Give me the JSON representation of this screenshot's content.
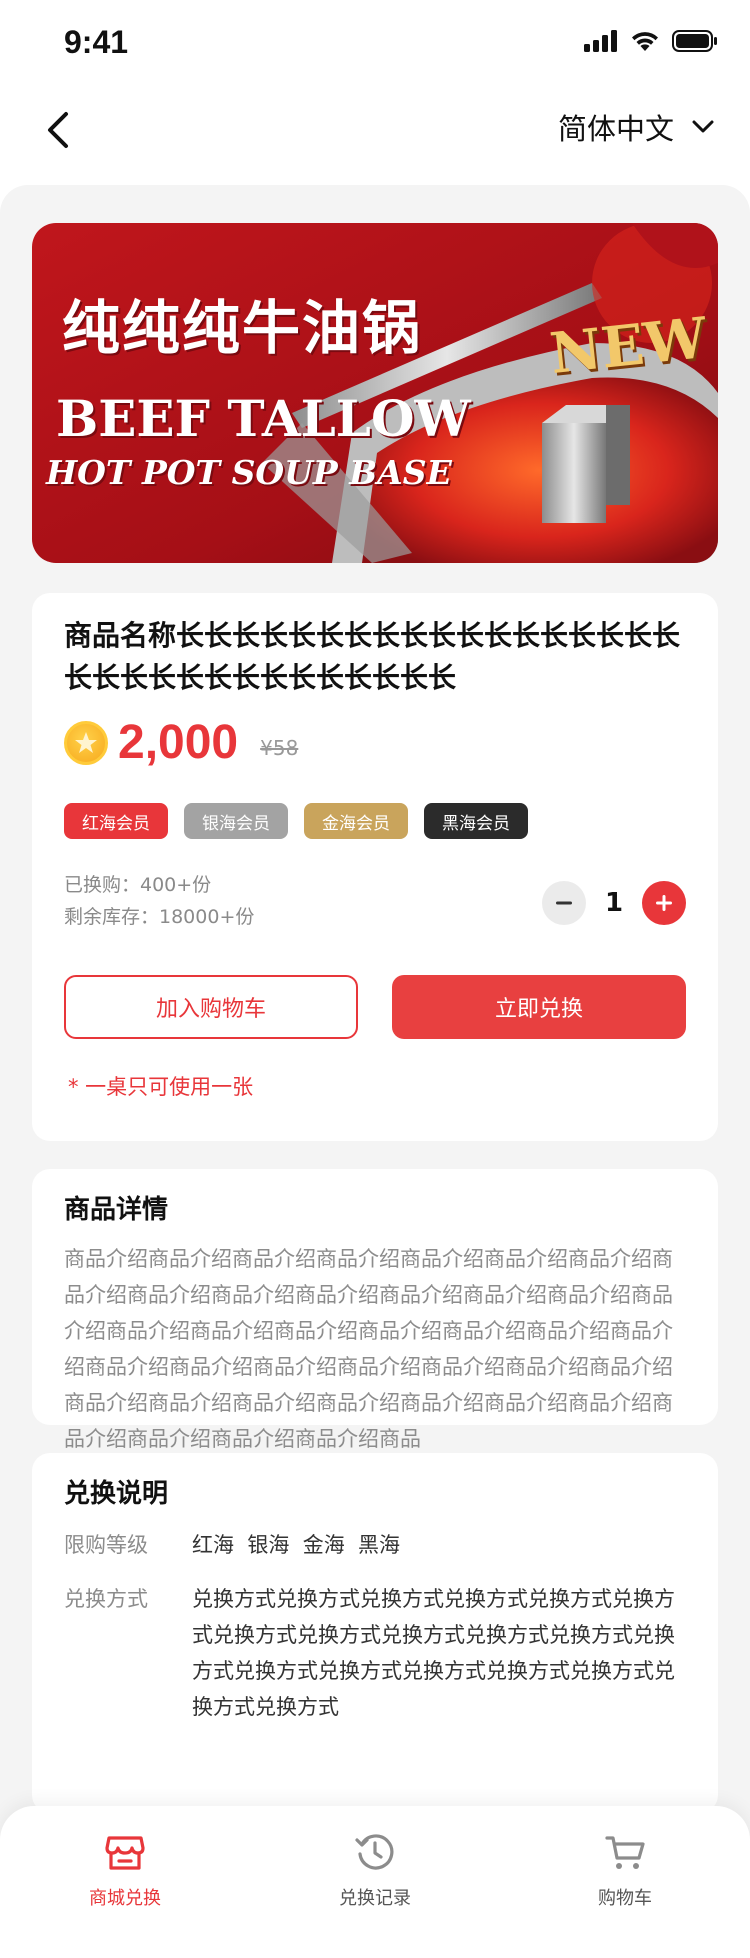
{
  "status_bar": {
    "time": "9:41"
  },
  "nav": {
    "language": "简体中文"
  },
  "banner": {
    "title_cn": "纯纯纯牛油锅",
    "line1": "BEEF TALLOW",
    "line2": "HOT POT SOUP BASE",
    "badge": "NEW"
  },
  "product": {
    "name": "商品名称长长长长长长长长长长长长长长长长长长长长长长长长长长长长长长长长",
    "price": "2,000",
    "original_price": "¥58",
    "tags": [
      {
        "label": "红海会员",
        "color": "#e8363a"
      },
      {
        "label": "银海会员",
        "color": "#a3a3a3"
      },
      {
        "label": "金海会员",
        "color": "#c9a45c"
      },
      {
        "label": "黑海会员",
        "color": "#2b2b2b"
      }
    ],
    "redeemed": "已换购：400+份",
    "stock": "剩余库存：18000+份",
    "quantity": "1",
    "add_to_cart": "加入购物车",
    "redeem_now": "立即兑换",
    "notice": "* 一桌只可使用一张"
  },
  "details": {
    "title": "商品详情",
    "text": "商品介绍商品介绍商品介绍商品介绍商品介绍商品介绍商品介绍商品介绍商品介绍商品介绍商品介绍商品介绍商品介绍商品介绍商品介绍商品介绍商品介绍商品介绍商品介绍商品介绍商品介绍商品介绍商品介绍商品介绍商品介绍商品介绍商品介绍商品介绍商品介绍商品介绍商品介绍商品介绍商品介绍商品介绍商品介绍商品介绍商品介绍商品介绍商品介绍商品介绍商品"
  },
  "exchange": {
    "title": "兑换说明",
    "level_label": "限购等级",
    "level_value": "红海  银海  金海  黑海",
    "method_label": "兑换方式",
    "method_value": "兑换方式兑换方式兑换方式兑换方式兑换方式兑换方式兑换方式兑换方式兑换方式兑换方式兑换方式兑换方式兑换方式兑换方式兑换方式兑换方式兑换方式兑换方式兑换方式"
  },
  "tabbar": {
    "shop": "商城兑换",
    "records": "兑换记录",
    "cart": "购物车"
  },
  "colors": {
    "accent": "#e8363a"
  }
}
